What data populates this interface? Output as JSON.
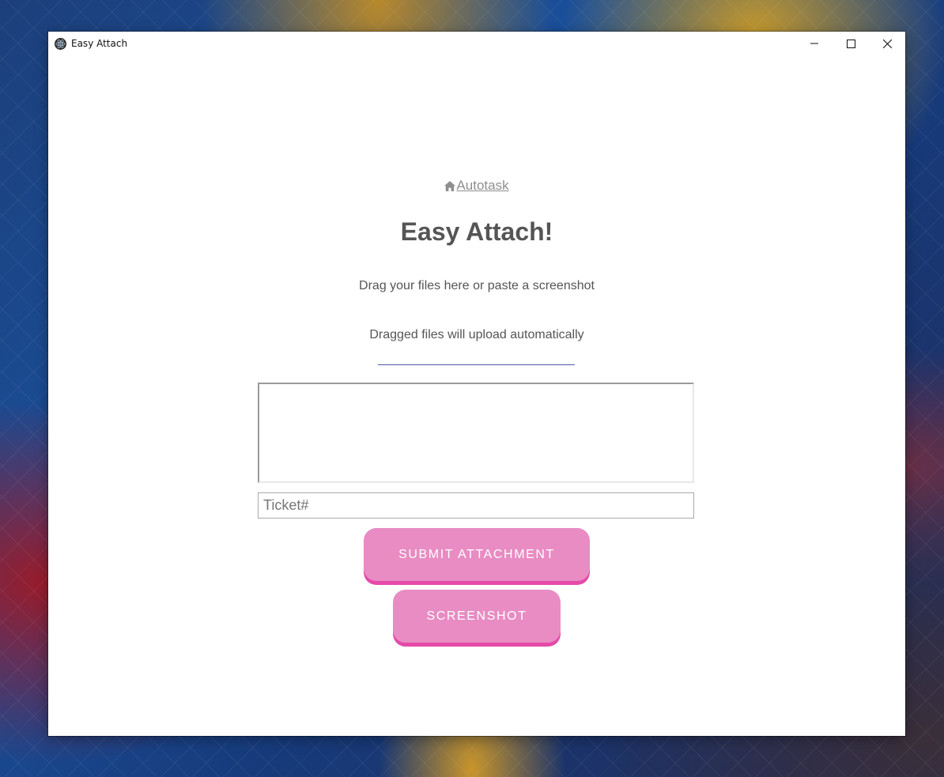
{
  "window": {
    "title": "Easy Attach",
    "controls": {
      "minimize": "minimize",
      "maximize": "maximize",
      "close": "close"
    }
  },
  "header": {
    "home_link_label": "Autotask",
    "title": "Easy Attach!"
  },
  "instructions": {
    "line1": "Drag your files here or paste a screenshot",
    "line2": "Dragged files will upload automatically"
  },
  "form": {
    "description_value": "",
    "ticket_placeholder": "Ticket#",
    "ticket_value": ""
  },
  "buttons": {
    "submit_label": "SUBMIT ATTACHMENT",
    "screenshot_label": "SCREENSHOT"
  },
  "colors": {
    "button_fill": "#e88cc3",
    "button_shadow": "#e54aa9",
    "text_gray": "#555555",
    "link_gray": "#8e8e8e",
    "divider": "#4a5aa8"
  },
  "icons": {
    "app": "electron-atom-icon",
    "home": "home-icon",
    "minimize": "minimize-icon",
    "maximize": "maximize-icon",
    "close": "close-icon"
  }
}
